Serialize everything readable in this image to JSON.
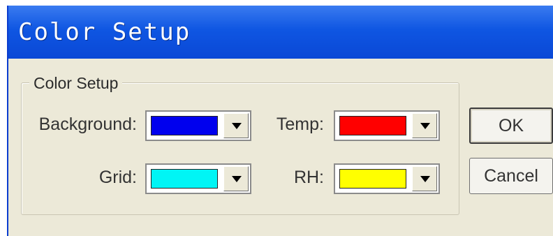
{
  "window": {
    "title": "Color Setup"
  },
  "group": {
    "label": "Color Setup"
  },
  "fields": {
    "background": {
      "label": "Background:",
      "color": "#0000ee"
    },
    "temp": {
      "label": "Temp:",
      "color": "#ff0000"
    },
    "grid": {
      "label": "Grid:",
      "color": "#00f5f5"
    },
    "rh": {
      "label": "RH:",
      "color": "#ffff00"
    }
  },
  "buttons": {
    "ok_label": "OK",
    "cancel_label": "Cancel"
  },
  "icons": {
    "dropdown": "triangle-down-icon"
  }
}
